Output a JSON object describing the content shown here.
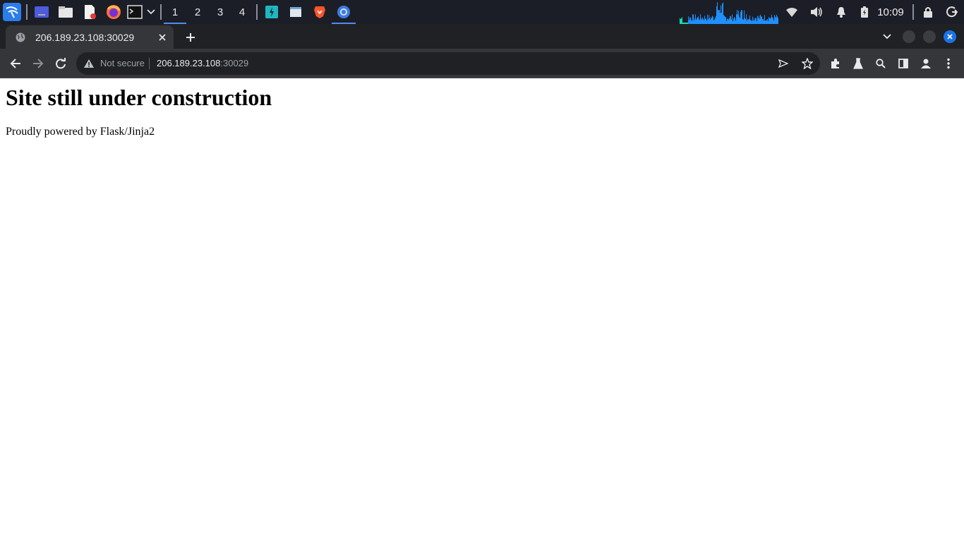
{
  "panel": {
    "workspaces": [
      "1",
      "2",
      "3",
      "4"
    ],
    "active_workspace": "1",
    "clock": "10:09",
    "launchers": [
      "kali-menu-icon",
      "desktop-icon",
      "file-manager-icon",
      "text-editor-icon",
      "firefox-icon",
      "terminal-icon"
    ],
    "tasks": [
      "burpsuite-icon",
      "window-icon",
      "brave-icon",
      "chromium-icon"
    ]
  },
  "browser": {
    "tab": {
      "title": "206.189.23.108:30029"
    },
    "security_label": "Not secure",
    "url": {
      "host": "206.189.23.108",
      "port": ":30029"
    }
  },
  "page": {
    "heading": "Site still under construction",
    "text": "Proudly powered by Flask/Jinja2"
  },
  "colors": {
    "panel_bg": "#1b1e27",
    "tabstrip_bg": "#202124",
    "toolbar_bg": "#35363a",
    "accent": "#4d8cf0",
    "close_window": "#1a73e8",
    "graph": "#1e90ff"
  }
}
